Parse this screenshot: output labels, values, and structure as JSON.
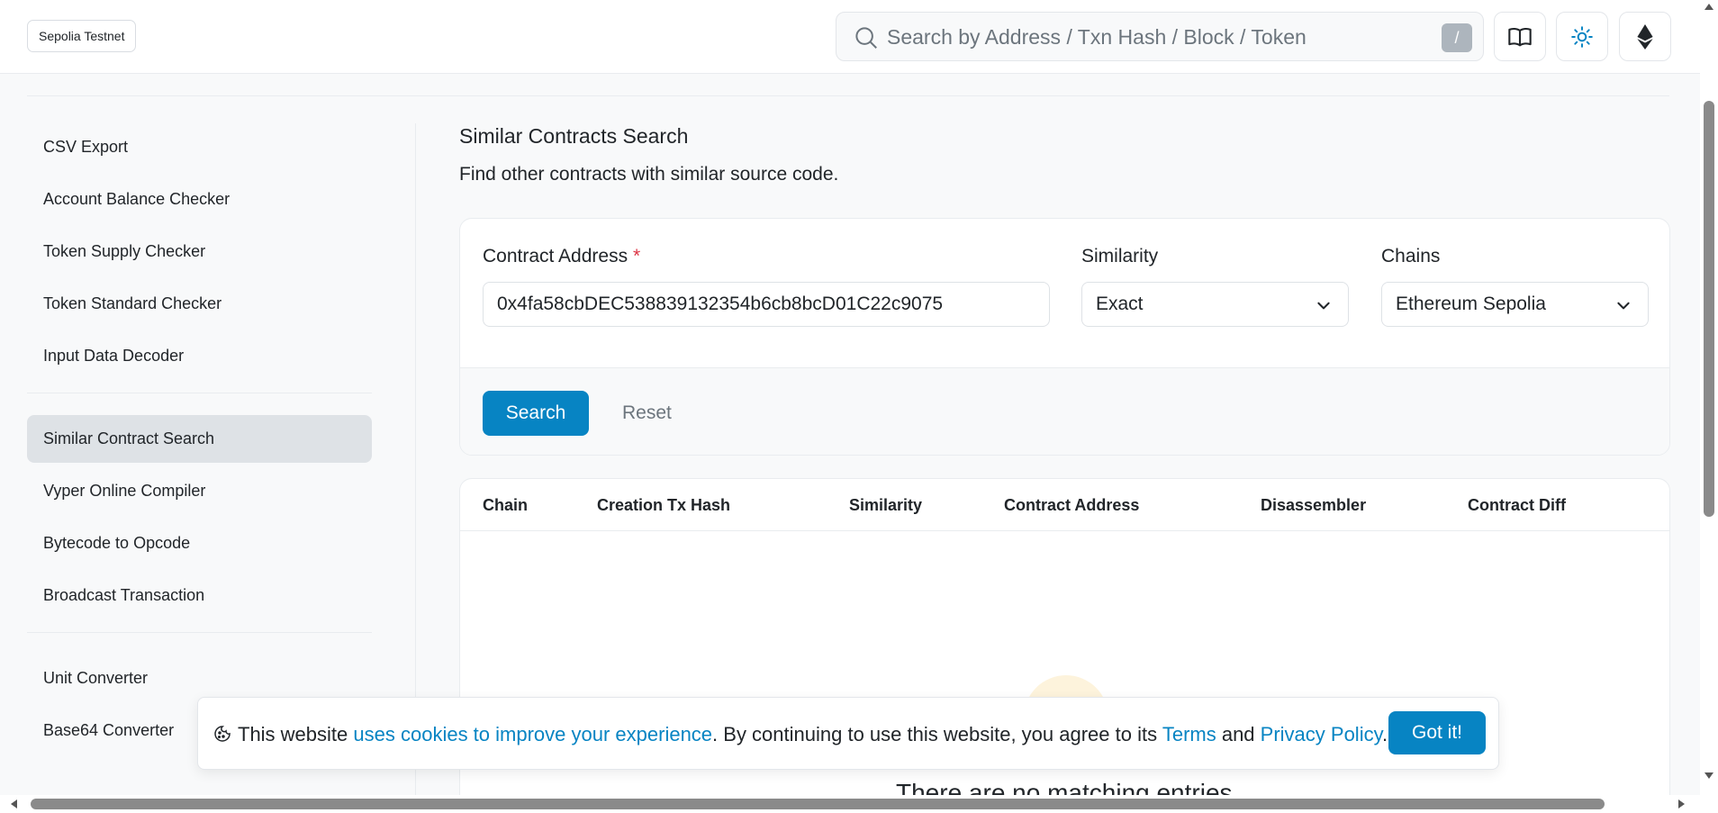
{
  "header": {
    "network_badge": "Sepolia Testnet",
    "search_placeholder": "Search by Address / Txn Hash / Block / Token",
    "search_shortcut": "/",
    "icons": [
      "book-icon",
      "sun-icon",
      "ethereum-icon"
    ]
  },
  "sidebar": {
    "groups": [
      [
        "CSV Export",
        "Account Balance Checker",
        "Token Supply Checker",
        "Token Standard Checker",
        "Input Data Decoder"
      ],
      [
        "Similar Contract Search",
        "Vyper Online Compiler",
        "Bytecode to Opcode",
        "Broadcast Transaction"
      ],
      [
        "Unit Converter",
        "Base64 Converter"
      ]
    ],
    "active": "Similar Contract Search"
  },
  "main": {
    "title": "Similar Contracts Search",
    "subtitle": "Find other contracts with similar source code.",
    "form": {
      "contract_label": "Contract Address",
      "required_mark": "*",
      "contract_value": "0x4fa58cbDEC538839132354b6cb8bcD01C22c9075",
      "similarity_label": "Similarity",
      "similarity_value": "Exact",
      "chains_label": "Chains",
      "chains_value": "Ethereum Sepolia",
      "search_button": "Search",
      "reset_button": "Reset"
    },
    "table": {
      "columns": [
        "Chain",
        "Creation Tx Hash",
        "Similarity",
        "Contract Address",
        "Disassembler",
        "Contract Diff"
      ],
      "empty_text": "There are no matching entries"
    }
  },
  "cookie_banner": {
    "text_1": "This website ",
    "link_1": "uses cookies to improve your experience",
    "text_2": ". By continuing to use this website, you agree to its ",
    "link_2": "Terms",
    "text_3": " and ",
    "link_3": "Privacy Policy",
    "text_4": ".",
    "button": "Got it!"
  },
  "colors": {
    "accent": "#0784c3",
    "required": "#dc3545"
  }
}
